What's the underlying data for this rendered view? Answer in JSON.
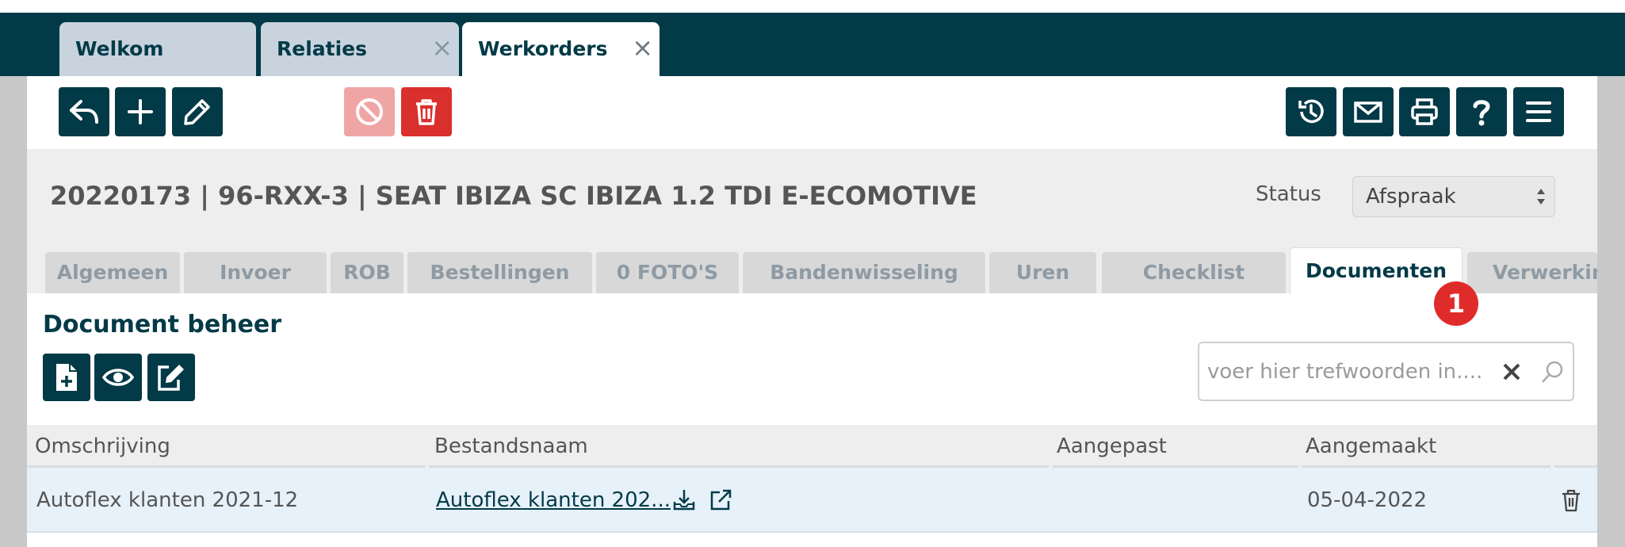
{
  "app_tabs": [
    {
      "label": "Welkom"
    },
    {
      "label": "Relaties",
      "close": "×"
    },
    {
      "label": "Werkorders",
      "close": "×"
    }
  ],
  "toolbar": {
    "left_icons": [
      "back-icon",
      "plus-icon",
      "pencil-icon"
    ],
    "action_icons": [
      "ban-icon",
      "trash-icon"
    ],
    "right_icons": [
      "history-icon",
      "mail-icon",
      "printer-icon",
      "question-icon",
      "menu-icon"
    ]
  },
  "header": {
    "title": "20220173 | 96-RXX-3 | SEAT IBIZA SC IBIZA 1.2 TDI E-ECOMOTIVE",
    "status_label": "Status",
    "status_value": "Afspraak"
  },
  "sub_tabs": [
    {
      "label": "Algemeen"
    },
    {
      "label": "Invoer"
    },
    {
      "label": "ROB"
    },
    {
      "label": "Bestellingen"
    },
    {
      "label": "0 FOTO'S"
    },
    {
      "label": "Bandenwisseling"
    },
    {
      "label": "Uren"
    },
    {
      "label": "Checklist"
    },
    {
      "label": "Documenten",
      "active": true
    },
    {
      "label": "Verwerking"
    }
  ],
  "badge": "1",
  "documents": {
    "title": "Document beheer",
    "search_placeholder": "voer hier trefwoorden in....",
    "columns": [
      "Omschrijving",
      "Bestandsnaam",
      "Aangepast",
      "Aangemaakt"
    ],
    "rows": [
      {
        "omschrijving": "Autoflex klanten 2021-12",
        "bestandsnaam": "Autoflex klanten 202...",
        "aangepast": "",
        "aangemaakt": "05-04-2022"
      }
    ]
  },
  "colors": {
    "primary": "#033a47",
    "danger": "#d9302e",
    "danger_disabled": "#f0a5a5",
    "badge": "#e02b2b",
    "row_highlight": "#e6f1fa"
  }
}
